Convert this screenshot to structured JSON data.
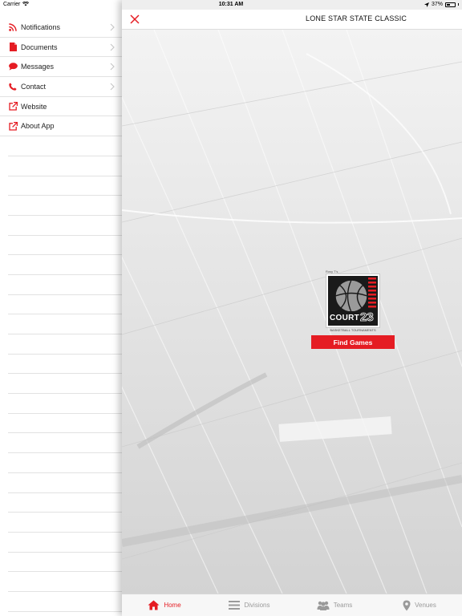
{
  "status_bar": {
    "carrier": "Carrier",
    "time": "10:31 AM",
    "battery": "37%"
  },
  "side_menu": {
    "items": [
      {
        "label": "Notifications",
        "icon": "rss-icon",
        "has_chevron": true
      },
      {
        "label": "Documents",
        "icon": "document-icon",
        "has_chevron": true
      },
      {
        "label": "Messages",
        "icon": "chat-bubble-icon",
        "has_chevron": true
      },
      {
        "label": "Contact",
        "icon": "phone-icon",
        "has_chevron": true
      },
      {
        "label": "Website",
        "icon": "external-link-icon",
        "has_chevron": false
      },
      {
        "label": "About App",
        "icon": "external-link-icon",
        "has_chevron": false
      }
    ]
  },
  "header": {
    "title": "LONE STAR STATE CLASSIC",
    "close_icon": "close-icon"
  },
  "logo": {
    "top_text": "Rosy T's",
    "main_text": "COURT",
    "number": "23",
    "bottom_text": "BASKETBALL TOURNAMENTS"
  },
  "find_button": {
    "label": "Find Games"
  },
  "tabs": [
    {
      "label": "Home",
      "icon": "home-icon",
      "active": true
    },
    {
      "label": "Divisions",
      "icon": "list-icon",
      "active": false
    },
    {
      "label": "Teams",
      "icon": "teams-icon",
      "active": false
    },
    {
      "label": "Venues",
      "icon": "map-pin-icon",
      "active": false
    }
  ],
  "colors": {
    "accent": "#e51c23",
    "inactive_tab": "#9a9a9a",
    "menu_divider": "#e2e2e2"
  }
}
